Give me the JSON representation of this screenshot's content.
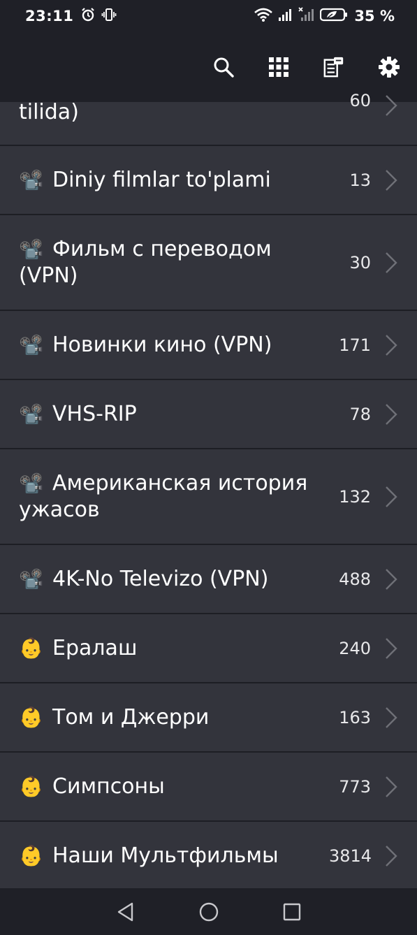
{
  "status": {
    "time": "23:11",
    "battery": "35 %",
    "icons": [
      "alarm-icon",
      "vibrate-icon",
      "wifi-icon",
      "signal-icon",
      "signal-off-icon",
      "battery-icon"
    ]
  },
  "toolbar": {
    "icons": [
      "search-icon",
      "grid-icon",
      "news-icon",
      "settings-icon"
    ]
  },
  "list": {
    "items": [
      {
        "title": "tilida)",
        "count": "60",
        "emoji": ""
      },
      {
        "title": "Diniy filmlar to'plami",
        "count": "13",
        "emoji": "📽️"
      },
      {
        "title": "Фильм с переводом (VPN)",
        "count": "30",
        "emoji": "📽️"
      },
      {
        "title": "Новинки кино (VPN)",
        "count": "171",
        "emoji": "📽️"
      },
      {
        "title": "VHS-RIP",
        "count": "78",
        "emoji": "📽️"
      },
      {
        "title": "Американская история ужасов",
        "count": "132",
        "emoji": "📽️"
      },
      {
        "title": "4K-No Televizo (VPN)",
        "count": "488",
        "emoji": "📽️"
      },
      {
        "title": "Ералаш",
        "count": "240",
        "emoji": "👶"
      },
      {
        "title": "Том и Джерри",
        "count": "163",
        "emoji": "👶"
      },
      {
        "title": "Симпсоны",
        "count": "773",
        "emoji": "👶"
      },
      {
        "title": "Наши Мультфильмы",
        "count": "3814",
        "emoji": "👶"
      }
    ]
  },
  "navbar": {
    "icons": [
      "back-icon",
      "home-icon",
      "recents-icon"
    ]
  },
  "colors": {
    "background": "#33343c",
    "bar": "#1f2027",
    "divider": "#1d1e24",
    "text": "#ffffff"
  }
}
